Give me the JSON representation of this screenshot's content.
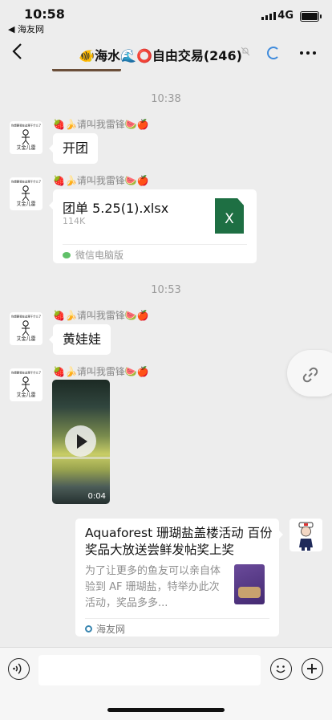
{
  "status_bar": {
    "time": "10:58",
    "back_app": "◀ 海友网",
    "network": "4G"
  },
  "header": {
    "back_icon": "chevron-left-icon",
    "title": "🐠海水🌊⭕自由交易(246)",
    "more_icon": "more-dots-icon"
  },
  "chat": {
    "timestamps": [
      "10:38",
      "10:53"
    ],
    "sender_name": "🍓🍌请叫我雷锋🍉🍎",
    "avatar": {
      "top_text": "你想要我在这里干什么了",
      "bottom_text": "艾金儿雷"
    },
    "messages": [
      {
        "type": "text",
        "text": "开团"
      },
      {
        "type": "file",
        "name": "团单 5.25(1).xlsx",
        "size": "114K",
        "icon_letter": "X",
        "source": "微信电脑版"
      },
      {
        "type": "text",
        "text": "黄娃娃"
      },
      {
        "type": "video",
        "duration": "0:04"
      },
      {
        "type": "link",
        "title": "Aquaforest 珊瑚盐盖楼活动 百份奖品大放送尝鲜发帖奖上奖",
        "description": "为了让更多的鱼友可以亲自体验到 AF 珊瑚盐，特举办此次活动，奖品多多...",
        "source": "海友网"
      }
    ]
  },
  "colors": {
    "background": "#ededed",
    "excel_green": "#1e6f43",
    "bubble": "#ffffff"
  }
}
